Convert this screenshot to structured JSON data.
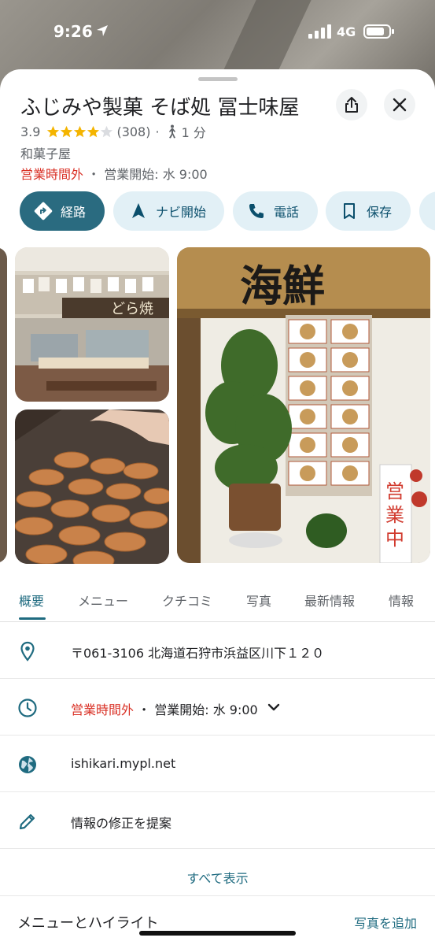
{
  "status_bar": {
    "time": "9:26",
    "network": "4G"
  },
  "place": {
    "name": "ふじみや製菓 そば処 冨士味屋",
    "rating": "3.9",
    "rating_stars": 4,
    "review_count": "(308)",
    "separator": "·",
    "walk_time": "1 分",
    "category": "和菓子屋",
    "status": "営業時間外",
    "dot": "・",
    "opening": "営業開始: 水 9:00"
  },
  "actions": {
    "route": "経路",
    "navigate": "ナビ開始",
    "call": "電話",
    "save": "保存"
  },
  "photos": {
    "sign_text": "海鮮",
    "open_sign": "営業中",
    "dorayaki": "どら焼"
  },
  "tabs": [
    "概要",
    "メニュー",
    "クチコミ",
    "写真",
    "最新情報",
    "情報"
  ],
  "info": {
    "address": "〒061-3106 北海道石狩市浜益区川下１２０",
    "hours_status": "営業時間外",
    "hours_dot": "・",
    "hours_opening": "営業開始: 水 9:00",
    "website": "ishikari.mypl.net",
    "suggest_edit": "情報の修正を提案"
  },
  "show_all": "すべて表示",
  "section": {
    "title": "メニューとハイライト",
    "add_photo": "写真を追加"
  },
  "colors": {
    "accent": "#1f6b80",
    "closed": "#d93025",
    "chip_bg": "#e2f0f6",
    "star": "#f4b400"
  }
}
